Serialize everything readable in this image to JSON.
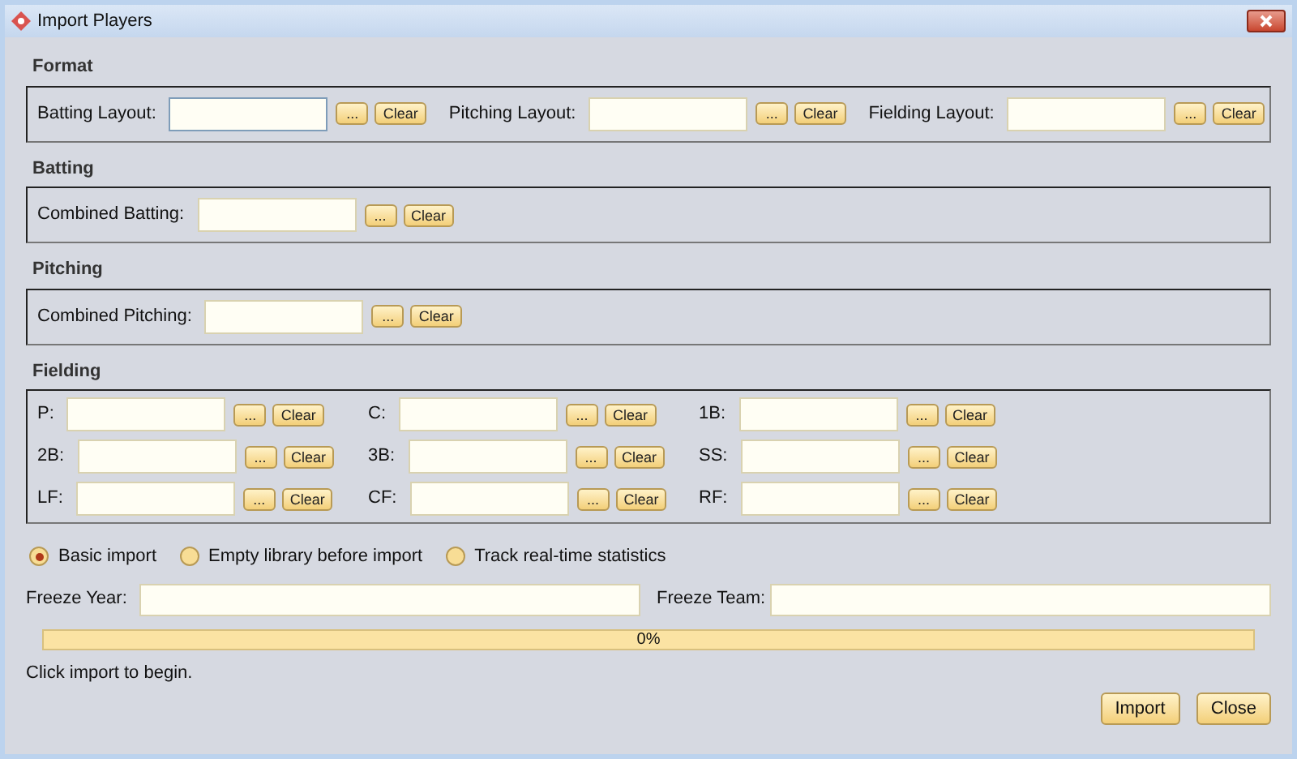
{
  "window": {
    "title": "Import Players"
  },
  "sections": [
    {
      "title": "Format",
      "rows": [
        [
          {
            "label": "Batting Layout:",
            "browse": "...",
            "clear": "Clear",
            "focused": true
          },
          {
            "label": "Pitching Layout:",
            "browse": "...",
            "clear": "Clear",
            "focused": false
          },
          {
            "label": "Fielding Layout:",
            "browse": "...",
            "clear": "Clear",
            "focused": false
          }
        ]
      ]
    },
    {
      "title": "Batting",
      "rows": [
        [
          {
            "label": "Combined Batting:",
            "browse": "...",
            "clear": "Clear",
            "focused": false
          }
        ]
      ]
    },
    {
      "title": "Pitching",
      "rows": [
        [
          {
            "label": "Combined Pitching:",
            "browse": "...",
            "clear": "Clear",
            "focused": false
          }
        ]
      ]
    },
    {
      "title": "Fielding",
      "rows": [
        [
          {
            "label": "P:",
            "browse": "...",
            "clear": "Clear",
            "focused": false
          },
          {
            "label": "C:",
            "browse": "...",
            "clear": "Clear",
            "focused": false
          },
          {
            "label": "1B:",
            "browse": "...",
            "clear": "Clear",
            "focused": false
          }
        ],
        [
          {
            "label": "2B:",
            "browse": "...",
            "clear": "Clear",
            "focused": false
          },
          {
            "label": "3B:",
            "browse": "...",
            "clear": "Clear",
            "focused": false
          },
          {
            "label": "SS:",
            "browse": "...",
            "clear": "Clear",
            "focused": false
          }
        ],
        [
          {
            "label": "LF:",
            "browse": "...",
            "clear": "Clear",
            "focused": false
          },
          {
            "label": "CF:",
            "browse": "...",
            "clear": "Clear",
            "focused": false
          },
          {
            "label": "RF:",
            "browse": "...",
            "clear": "Clear",
            "focused": false
          }
        ]
      ]
    }
  ],
  "options": [
    {
      "label": "Basic import",
      "selected": true
    },
    {
      "label": "Empty library before import",
      "selected": false
    },
    {
      "label": "Track real-time statistics",
      "selected": false
    }
  ],
  "freeze": [
    {
      "label": "Freeze Year:"
    },
    {
      "label": "Freeze Team:"
    }
  ],
  "progress": {
    "level": 0,
    "text": "0%"
  },
  "status": "Click import to begin.",
  "buttons": [
    "Import",
    "Close"
  ]
}
